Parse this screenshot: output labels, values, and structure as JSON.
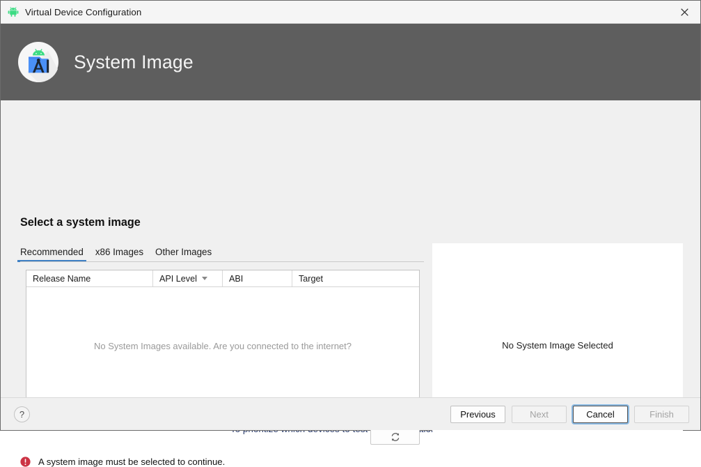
{
  "background": {
    "bottom_text": "To prioritize which devices to test your application on, visit"
  },
  "titlebar": {
    "title": "Virtual Device Configuration",
    "icon": "android-robot-icon",
    "close_icon": "close-icon"
  },
  "header": {
    "title": "System Image",
    "logo_icon": "android-studio-avd-icon",
    "background_color": "#5e5e5e"
  },
  "main": {
    "heading": "Select a system image",
    "tabs": [
      {
        "label": "Recommended",
        "active": true
      },
      {
        "label": "x86 Images",
        "active": false
      },
      {
        "label": "Other Images",
        "active": false
      }
    ],
    "table": {
      "columns": [
        {
          "label": "Release Name",
          "width": 182,
          "sorted": false
        },
        {
          "label": "API Level",
          "width": 100,
          "sorted": true,
          "sort_direction": "descending"
        },
        {
          "label": "ABI",
          "width": 100,
          "sorted": false
        },
        {
          "label": "Target",
          "width": 182,
          "sorted": false
        }
      ],
      "rows": [],
      "empty_message": "No System Images available. Are you connected to the internet?"
    },
    "refresh_button": {
      "icon": "refresh-icon",
      "label": ""
    },
    "preview": {
      "text": "No System Image Selected"
    },
    "validation": {
      "icon": "error-icon",
      "message": "A system image must be selected to continue.",
      "color": "#cc3344"
    }
  },
  "footer": {
    "help_label": "?",
    "buttons": [
      {
        "label": "Previous",
        "state": "enabled"
      },
      {
        "label": "Next",
        "state": "disabled"
      },
      {
        "label": "Cancel",
        "state": "focused"
      },
      {
        "label": "Finish",
        "state": "disabled"
      }
    ]
  },
  "colors": {
    "accent_blue": "#3f80c4",
    "header_gray": "#5e5e5e",
    "dialog_bg": "#f0f0f0",
    "error_red": "#cc3344",
    "link_blue": "#2b3c6b"
  }
}
